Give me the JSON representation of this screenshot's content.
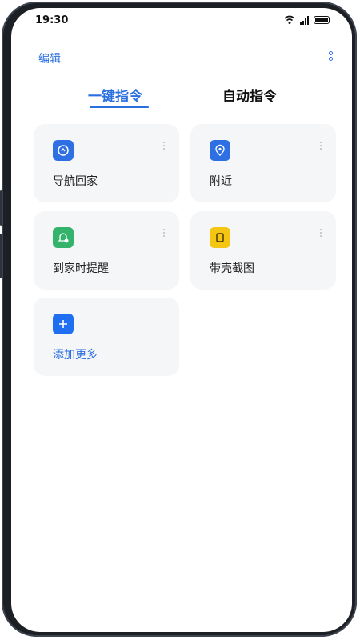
{
  "status_bar": {
    "time": "19:30"
  },
  "header": {
    "edit_label": "编辑"
  },
  "tabs": [
    {
      "label": "一键指令",
      "active": true
    },
    {
      "label": "自动指令",
      "active": false
    }
  ],
  "shortcuts": [
    {
      "label": "导航回家",
      "icon": "navigation-home-icon",
      "color": "#2f6fe4"
    },
    {
      "label": "附近",
      "icon": "location-pin-icon",
      "color": "#2f6fe4"
    },
    {
      "label": "到家时提醒",
      "icon": "home-reminder-icon",
      "color": "#33b36b"
    },
    {
      "label": "带壳截图",
      "icon": "screenshot-frame-icon",
      "color": "#f5c514"
    }
  ],
  "add_more": {
    "label": "添加更多",
    "icon": "plus-icon",
    "color": "#1f6ff0"
  },
  "colors": {
    "accent": "#2a6fe0",
    "card_bg": "#f5f6f8"
  }
}
